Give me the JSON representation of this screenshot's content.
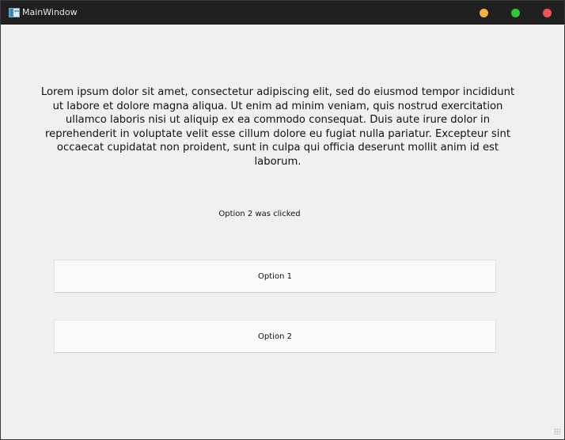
{
  "window": {
    "title": "MainWindow",
    "controls": {
      "minimize_icon": "minimize-icon",
      "maximize_icon": "maximize-icon",
      "close_icon": "close-icon",
      "minimize_color": "#f5b23a",
      "maximize_color": "#2ec733",
      "close_color": "#f25551"
    }
  },
  "main": {
    "lorem_text": "Lorem ipsum dolor sit amet, consectetur adipiscing elit, sed do eiusmod tempor incididunt ut labore et dolore magna aliqua. Ut enim ad minim veniam, quis nostrud exercitation ullamco laboris nisi ut aliquip ex ea commodo consequat. Duis aute irure dolor in reprehenderit in voluptate velit esse cillum dolore eu fugiat nulla pariatur. Excepteur sint occaecat cupidatat non proident, sunt in culpa qui officia deserunt mollit anim id est laborum.",
    "status_text": "Option 2 was clicked",
    "options": [
      {
        "label": "Option 1"
      },
      {
        "label": "Option 2"
      }
    ]
  }
}
